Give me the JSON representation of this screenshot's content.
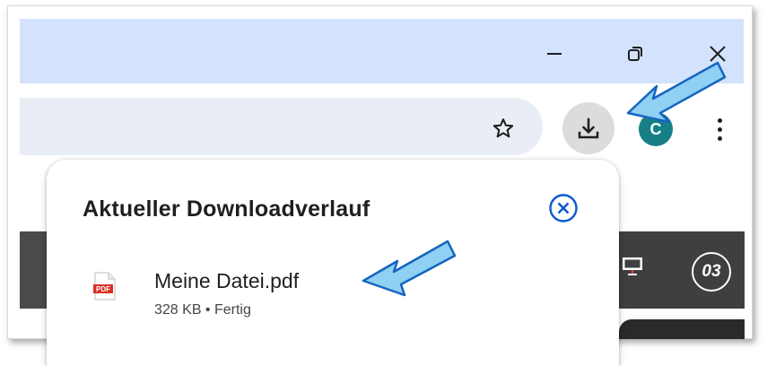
{
  "window": {
    "minimize_icon": "minimize-icon",
    "restore_icon": "restore-icon",
    "close_icon": "close-icon"
  },
  "toolbar": {
    "bookmark_icon": "star-icon",
    "download_icon": "download-icon",
    "profile_initial": "C",
    "menu_icon": "more-vert-icon"
  },
  "page": {
    "badge_text": "03",
    "monitor_icon": "monitor-icon"
  },
  "downloads": {
    "title": "Aktueller Downloadverlauf",
    "close_icon": "close-circle-icon",
    "items": [
      {
        "file_name": "Meine Datei.pdf",
        "meta": "328 KB • Fertig",
        "icon": "pdf-file-icon",
        "icon_label": "PDF"
      }
    ]
  },
  "annotations": {
    "arrow_color": "#8fd0f3",
    "arrow_outline": "#1565c0"
  },
  "colors": {
    "titlebar": "#d3e3fd",
    "omnibox": "#e9eef6",
    "download_button_bg": "#dcdcdc",
    "avatar": "#178086",
    "close_circle": "#0b57d0",
    "pdf_red": "#d93025"
  }
}
